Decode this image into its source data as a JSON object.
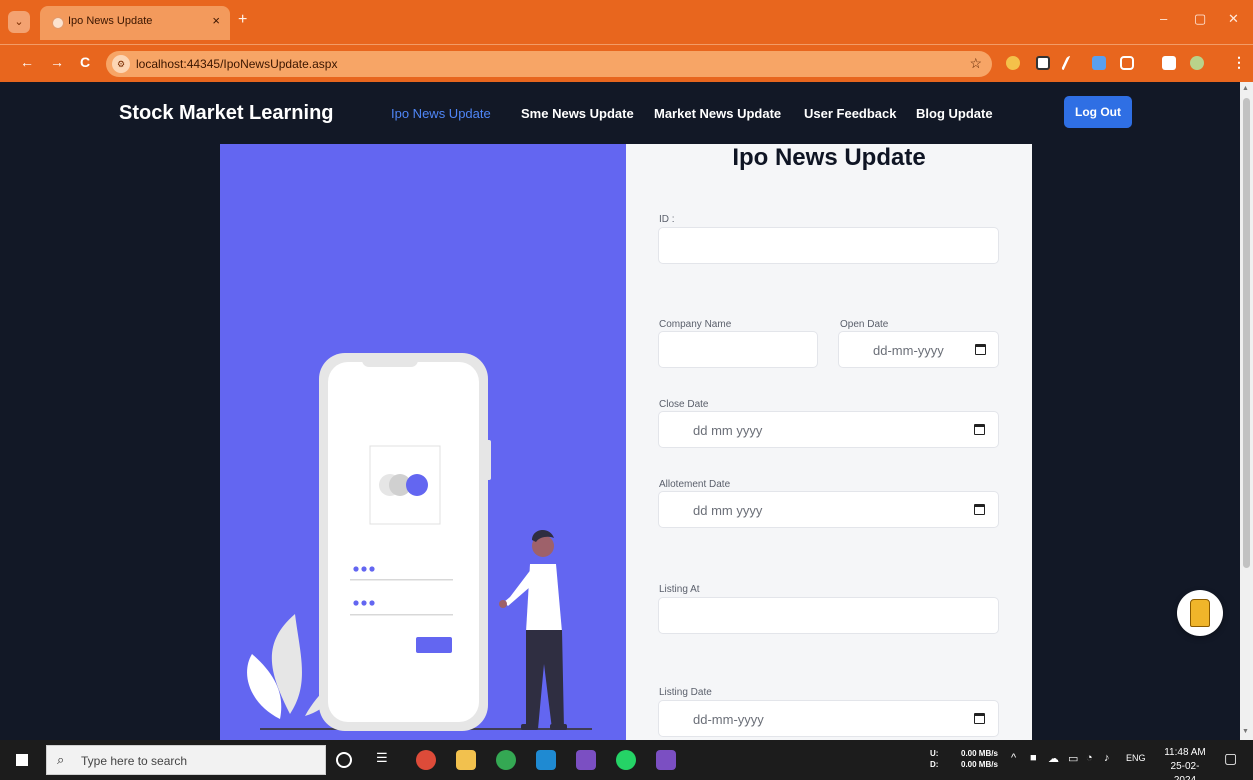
{
  "browser": {
    "tab_title": "Ipo News Update",
    "tab_close": "×",
    "new_tab": "+",
    "url": "localhost:44345/IpoNewsUpdate.aspx",
    "window_controls": [
      "–",
      "▢",
      "✕"
    ],
    "nav": {
      "back": "←",
      "forward": "→",
      "reload": "C"
    },
    "star": "☆"
  },
  "navbar": {
    "brand": "Stock Market Learning",
    "links": [
      {
        "label": "Ipo News Update",
        "active": true
      },
      {
        "label": "Sme News Update"
      },
      {
        "label": "Market News Update"
      },
      {
        "label": "User Feedback"
      },
      {
        "label": "Blog Update"
      }
    ],
    "logout": "Log Out"
  },
  "form": {
    "title": "Ipo News Update",
    "fields": {
      "id": {
        "label": "ID :",
        "value": ""
      },
      "company_name": {
        "label": "Company Name",
        "value": ""
      },
      "open_date": {
        "label": "Open Date",
        "placeholder": "dd-mm-yyyy"
      },
      "close_date": {
        "label": "Close Date",
        "placeholder": "dd mm yyyy"
      },
      "allotment_date": {
        "label": "Allotement Date",
        "placeholder": "dd mm yyyy"
      },
      "listing_at": {
        "label": "Listing At",
        "value": ""
      },
      "listing_date": {
        "label": "Listing Date",
        "placeholder": "dd-mm-yyyy"
      }
    }
  },
  "taskbar": {
    "search_placeholder": "Type here to search",
    "net_up_label": "U:",
    "net_down_label": "D:",
    "net_up": "0.00 MB/s",
    "net_down": "0.00 MB/s",
    "lang": "ENG",
    "time": "11:48 AM",
    "date": "25-02-2024"
  },
  "colors": {
    "tab_bar": "#e8661e",
    "page_bg": "#121826",
    "illustration_bg": "#6366f1",
    "form_bg": "#f5f6f8",
    "active_link": "#4f86f7",
    "logout_button": "#2f6fe4"
  }
}
